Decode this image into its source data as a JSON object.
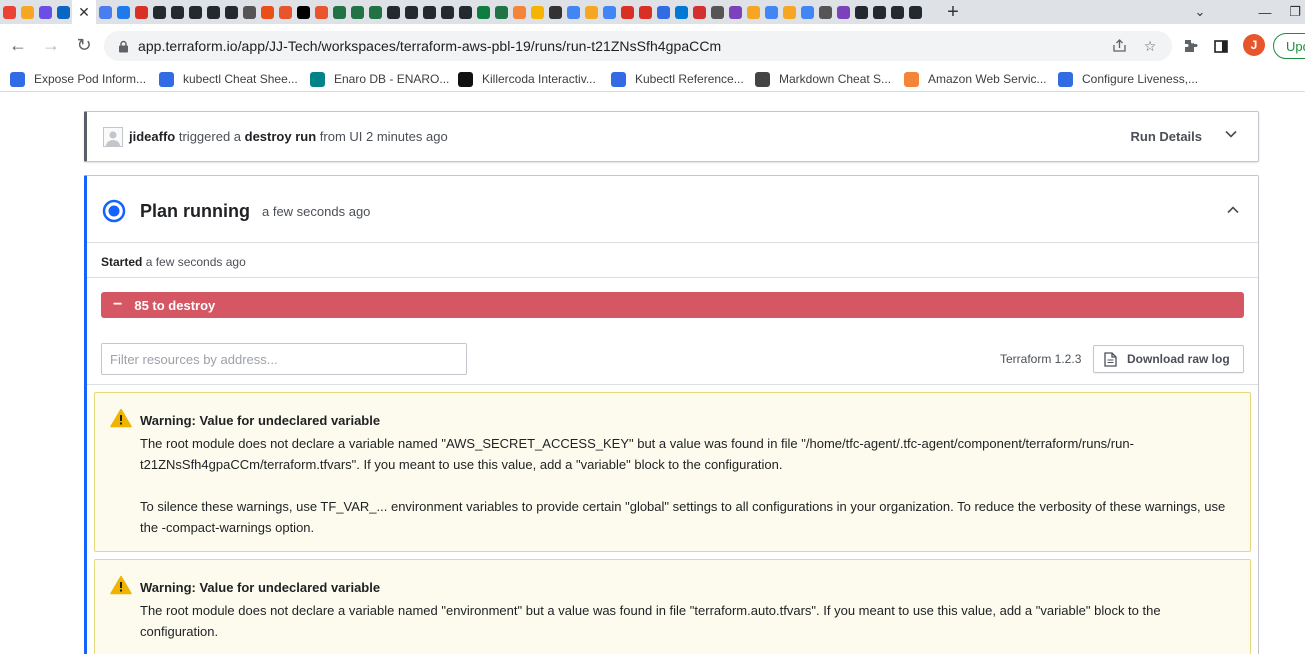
{
  "browser": {
    "tab_colors": [
      "#ea4335",
      "#f5a623",
      "#6b4ee6",
      "#0a66c2",
      "#ffffff",
      "#4a7df0",
      "#1f7aec",
      "#d93025",
      "#24292f",
      "#24292f",
      "#24292f",
      "#24292f",
      "#24292f",
      "#555555",
      "#e94e1b",
      "#e8542b",
      "#000000",
      "#e8542b",
      "#217346",
      "#217346",
      "#217346",
      "#24292f",
      "#24292f",
      "#24292f",
      "#24292f",
      "#24292f",
      "#0f7c41",
      "#217346",
      "#f58536",
      "#f5b400",
      "#333333",
      "#4285f4",
      "#f5a623",
      "#4285f4",
      "#d93025",
      "#d93025",
      "#326ce5",
      "#0078d4",
      "#d32f2f",
      "#555555",
      "#7b42bc",
      "#f5a623",
      "#4285f4",
      "#f5a623",
      "#4285f4",
      "#555555",
      "#7b42bc",
      "#24292f",
      "#24292f",
      "#24292f",
      "#24292f"
    ],
    "active_tab_close": "✕",
    "new_tab": "+",
    "back": "←",
    "forward": "→",
    "reload": "↻",
    "url": "app.terraform.io/app/JJ-Tech/workspaces/terraform-aws-pbl-19/runs/run-t21ZNsSfh4gpaCCm",
    "profile_initial": "J",
    "update_label": "Upd",
    "bookmarks": [
      {
        "label": "Expose Pod Inform...",
        "icon": "kubernetes-icon",
        "color": "#326ce5"
      },
      {
        "label": "kubectl Cheat Shee...",
        "icon": "kubernetes-icon",
        "color": "#326ce5"
      },
      {
        "label": "Enaro DB - ENARO...",
        "icon": "sharepoint-icon",
        "color": "#038387"
      },
      {
        "label": "Killercoda Interactiv...",
        "icon": "killercoda-icon",
        "color": "#111111"
      },
      {
        "label": "Kubectl Reference...",
        "icon": "kubernetes-icon",
        "color": "#326ce5"
      },
      {
        "label": "Markdown Cheat S...",
        "icon": "markdown-icon",
        "color": "#444444"
      },
      {
        "label": "Amazon Web Servic...",
        "icon": "aws-icon",
        "color": "#f58536"
      },
      {
        "label": "Configure Liveness,...",
        "icon": "kubernetes-icon",
        "color": "#326ce5"
      }
    ]
  },
  "run": {
    "user": "jideaffo",
    "triggered": "triggered a",
    "run_type": "destroy run",
    "source": "from UI 2 minutes ago",
    "details_label": "Run Details"
  },
  "plan": {
    "title": "Plan running",
    "time": "a few seconds ago",
    "started_label": "Started",
    "started_time": "a few seconds ago",
    "destroy_sign": "−",
    "destroy_text": "85 to destroy",
    "filter_placeholder": "Filter resources by address...",
    "terraform_version": "Terraform 1.2.3",
    "download_label": "Download raw log"
  },
  "warnings": [
    {
      "title": "Warning: Value for undeclared variable",
      "body": [
        "The root module does not declare a variable named \"AWS_SECRET_ACCESS_KEY\" but a value was found in file \"/home/tfc-agent/.tfc-agent/component/terraform/runs/run-t21ZNsSfh4gpaCCm/terraform.tfvars\". If you meant to use this value, add a \"variable\" block to the configuration.",
        "To silence these warnings, use TF_VAR_... environment variables to provide certain \"global\" settings to all configurations in your organization. To reduce the verbosity of these warnings, use the -compact-warnings option."
      ]
    },
    {
      "title": "Warning: Value for undeclared variable",
      "body": [
        "The root module does not declare a variable named \"environment\" but a value was found in file \"terraform.auto.tfvars\". If you meant to use this value, add a \"variable\" block to the configuration."
      ]
    }
  ],
  "colors": {
    "accent_blue": "#1563ff",
    "destroy_red": "#d55763",
    "warning_bg": "#fcfbee",
    "warning_border": "#e5d97c",
    "warning_icon": "#f0b400"
  }
}
